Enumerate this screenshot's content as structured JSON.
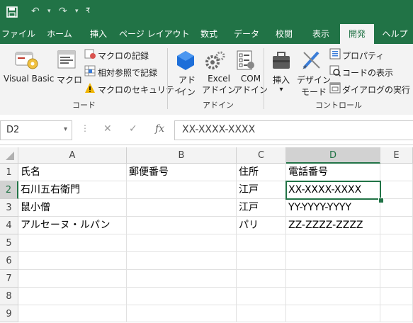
{
  "quick_access": {
    "save_icon": "save-icon",
    "undo_icon": "undo-icon",
    "redo_icon": "redo-icon",
    "customize_icon": "customize-qat-icon"
  },
  "tabs": [
    {
      "label": "ファイル"
    },
    {
      "label": "ホーム"
    },
    {
      "label": "挿入"
    },
    {
      "label": "ページ レイアウト"
    },
    {
      "label": "数式"
    },
    {
      "label": "データ"
    },
    {
      "label": "校閲"
    },
    {
      "label": "表示"
    },
    {
      "label": "開発",
      "active": true
    },
    {
      "label": "ヘルプ"
    }
  ],
  "ribbon": {
    "code": {
      "visual_basic": "Visual Basic",
      "macro": "マクロ",
      "record_macro": "マクロの記録",
      "relative_ref": "相対参照で記録",
      "macro_security": "マクロのセキュリティ",
      "group_label": "コード"
    },
    "addins": {
      "addin_1": "アド",
      "addin_2": "イン",
      "excel_1": "Excel",
      "excel_2": "アドイン",
      "com_1": "COM",
      "com_2": "アドイン",
      "group_label": "アドイン"
    },
    "controls": {
      "insert": "挿入",
      "insert_arrow": "▾",
      "design_1": "デザイン",
      "design_2": "モード",
      "properties": "プロパティ",
      "view_code": "コードの表示",
      "run_dialog": "ダイアログの実行",
      "group_label": "コントロール"
    }
  },
  "formula_bar": {
    "name_box": "D2",
    "dropdown": "▾",
    "more": "⋮",
    "cancel": "✕",
    "enter": "✓",
    "fx": "fx",
    "value": "XX-XXXX-XXXX"
  },
  "sheet": {
    "columns": [
      "A",
      "B",
      "C",
      "D",
      "E"
    ],
    "rows": [
      {
        "num": "1",
        "cells": [
          "氏名",
          "郵便番号",
          "住所",
          "電話番号"
        ]
      },
      {
        "num": "2",
        "cells": [
          "石川五右衛門",
          "",
          "江戸",
          "XX-XXXX-XXXX"
        ]
      },
      {
        "num": "3",
        "cells": [
          "鼠小僧",
          "",
          "江戸",
          "YY-YYYY-YYYY"
        ]
      },
      {
        "num": "4",
        "cells": [
          "アルセーヌ・ルパン",
          "",
          "パリ",
          "ZZ-ZZZZ-ZZZZ"
        ]
      },
      {
        "num": "5",
        "cells": [
          "",
          "",
          "",
          ""
        ]
      },
      {
        "num": "6",
        "cells": [
          "",
          "",
          "",
          ""
        ]
      },
      {
        "num": "7",
        "cells": [
          "",
          "",
          "",
          ""
        ]
      },
      {
        "num": "8",
        "cells": [
          "",
          "",
          "",
          ""
        ]
      },
      {
        "num": "9",
        "cells": [
          "",
          "",
          "",
          ""
        ]
      }
    ],
    "active_cell": "D2"
  },
  "colors": {
    "accent": "#217346",
    "ribbon_bg": "#f3f3f3",
    "header_bg": "#f3f3f3"
  }
}
